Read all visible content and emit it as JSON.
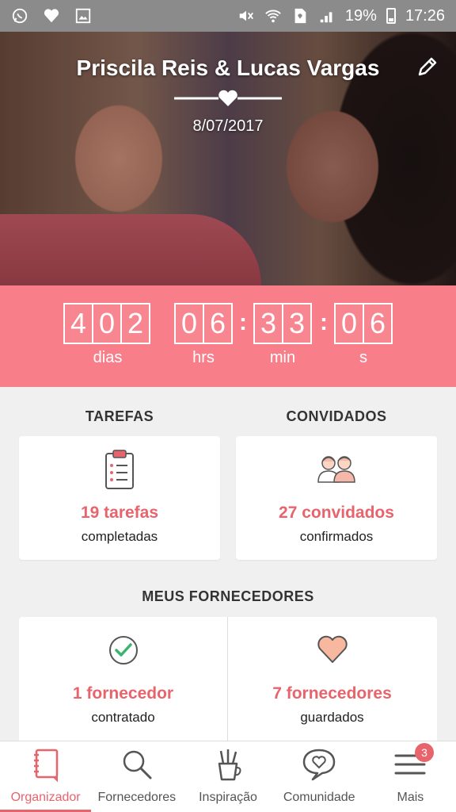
{
  "status_bar": {
    "battery": "19%",
    "time": "17:26",
    "icons": [
      "whatsapp-icon",
      "heart-icon",
      "image-icon",
      "mute-icon",
      "wifi-icon",
      "sim-icon",
      "signal-icon",
      "battery-icon"
    ]
  },
  "hero": {
    "couple_name": "Priscila Reis & Lucas Vargas",
    "date": "8/07/2017"
  },
  "countdown": {
    "days": [
      "4",
      "0",
      "2"
    ],
    "hours": [
      "0",
      "6"
    ],
    "minutes": [
      "3",
      "3"
    ],
    "seconds": [
      "0",
      "6"
    ],
    "labels": {
      "days": "dias",
      "hours": "hrs",
      "minutes": "min",
      "seconds": "s"
    },
    "color": "#f87f8a"
  },
  "tasks": {
    "title": "TAREFAS",
    "value": "19 tarefas",
    "sub": "completadas"
  },
  "guests": {
    "title": "CONVIDADOS",
    "value": "27 convidados",
    "sub": "confirmados"
  },
  "vendors": {
    "title": "MEUS FORNECEDORES",
    "hired": {
      "value": "1 fornecedor",
      "sub": "contratado"
    },
    "saved": {
      "value": "7 fornecedores",
      "sub": "guardados"
    }
  },
  "bottom_nav": {
    "items": [
      {
        "label": "Organizador",
        "icon": "notebook-icon",
        "active": true
      },
      {
        "label": "Fornecedores",
        "icon": "search-icon",
        "active": false
      },
      {
        "label": "Inspiração",
        "icon": "brush-cup-icon",
        "active": false
      },
      {
        "label": "Comunidade",
        "icon": "chat-heart-icon",
        "active": false
      },
      {
        "label": "Mais",
        "icon": "menu-icon",
        "active": false,
        "badge": "3"
      }
    ]
  },
  "accent_color": "#e8646d"
}
